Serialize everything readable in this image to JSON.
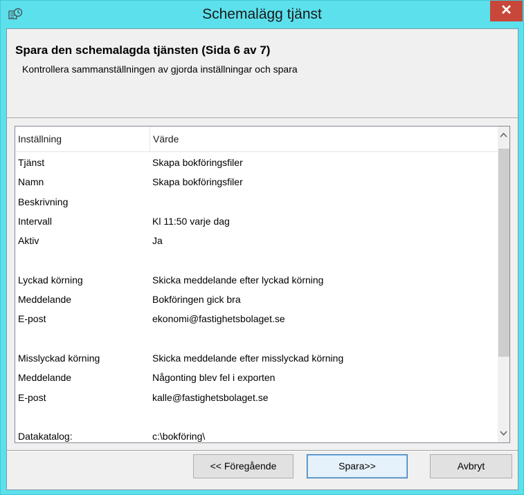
{
  "window": {
    "title": "Schemalägg tjänst",
    "icon": "scheduler-app-icon",
    "close_symbol": "✕"
  },
  "header": {
    "title": "Spara den schemalagda tjänsten  (Sida 6 av 7)",
    "subtitle": "Kontrollera sammanställningen av gjorda inställningar och spara"
  },
  "listview": {
    "columns": [
      "Inställning",
      "Värde"
    ],
    "rows": [
      {
        "setting": "Tjänst",
        "value": "Skapa bokföringsfiler"
      },
      {
        "setting": "Namn",
        "value": "Skapa bokföringsfiler"
      },
      {
        "setting": "Beskrivning",
        "value": ""
      },
      {
        "setting": "Intervall",
        "value": "Kl 11:50 varje dag"
      },
      {
        "setting": "Aktiv",
        "value": "Ja"
      },
      {
        "setting": "",
        "value": ""
      },
      {
        "setting": "Lyckad körning",
        "value": "Skicka meddelande efter lyckad körning"
      },
      {
        "setting": "Meddelande",
        "value": "Bokföringen gick bra"
      },
      {
        "setting": "E-post",
        "value": "ekonomi@fastighetsbolaget.se"
      },
      {
        "setting": "",
        "value": ""
      },
      {
        "setting": "Misslyckad körning",
        "value": "Skicka meddelande efter misslyckad körning"
      },
      {
        "setting": "Meddelande",
        "value": "Någonting blev fel i exporten"
      },
      {
        "setting": "E-post",
        "value": "kalle@fastighetsbolaget.se"
      },
      {
        "setting": "",
        "value": ""
      },
      {
        "setting": "Datakatalog:",
        "value": "c:\\bokföring\\"
      }
    ]
  },
  "buttons": {
    "previous": "<< Föregående",
    "save": "Spara>>",
    "cancel": "Avbryt"
  },
  "colors": {
    "titlebar": "#5ce0ec",
    "close_button": "#c7473a",
    "dialog_background": "#f0f0f0"
  }
}
